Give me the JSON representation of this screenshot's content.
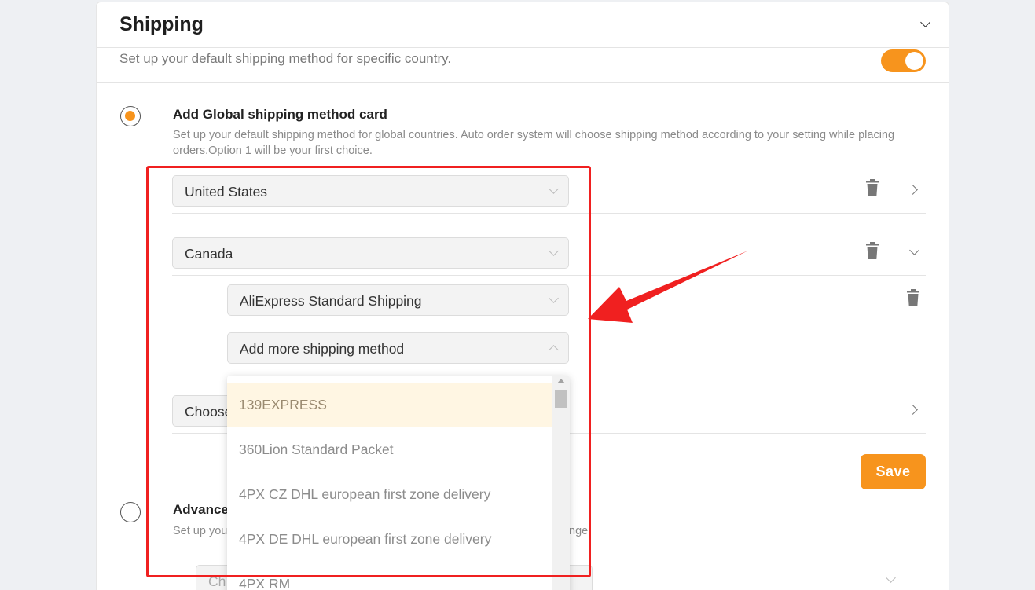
{
  "header": {
    "title": "Shipping"
  },
  "default_setting": {
    "description": "Set up your default shipping method for specific country.",
    "enabled": true
  },
  "global_option": {
    "title": "Add Global shipping method card",
    "description": "Set up your default shipping method for global countries. Auto order system will choose shipping method according to your setting while placing orders.Option 1 will be your first choice.",
    "selected": true
  },
  "countries": [
    {
      "name": "United States"
    },
    {
      "name": "Canada"
    },
    {
      "name": "Choose"
    }
  ],
  "shipping_methods": [
    {
      "name": "AliExpress Standard Shipping"
    }
  ],
  "add_method": {
    "placeholder": "Add more shipping method"
  },
  "dropdown": {
    "options": [
      "139EXPRESS",
      "360Lion Standard Packet",
      "4PX CZ DHL european first zone delivery",
      "4PX DE DHL european first zone delivery",
      "4PX RM"
    ],
    "highlighted": "139EXPRESS"
  },
  "save_label": "Save",
  "advanced_option": {
    "title": "Advance",
    "description": "Set up you",
    "description_tail": "nge.",
    "selected": false
  },
  "lower_select": {
    "value": "Ch"
  },
  "colors": {
    "accent": "#f7941d",
    "annotation": "#f02020"
  }
}
